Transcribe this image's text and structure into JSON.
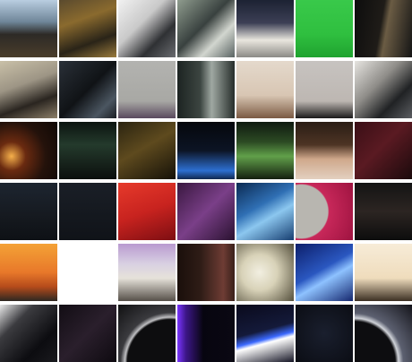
{
  "gallery": {
    "tiles": [
      {
        "name": "tile-monitors-rack",
        "bg": "linear-gradient(180deg,#b9cde0 0%,#6f8699 38%,#2d2a26 60%,#4a3d2b 100%)"
      },
      {
        "name": "tile-broadcast-console",
        "bg": "linear-gradient(160deg,#5a4a2e 0%,#8a6a2e 35%,#2a2418 70%,#9a7b3c 100%)"
      },
      {
        "name": "tile-studio-camera-white",
        "bg": "linear-gradient(135deg,#f1f1f1 0%,#c9c9c9 40%,#2f3134 70%,#6a6c70 100%)"
      },
      {
        "name": "tile-camera-operator",
        "bg": "linear-gradient(135deg,#8f9c8e 0%,#39413f 45%,#d2d6cf 70%,#596362 100%)"
      },
      {
        "name": "tile-camera-rig-blue",
        "bg": "linear-gradient(180deg,#1c2233 0%,#3c3f55 40%,#e9e6de 70%,#8b8a86 100%)"
      },
      {
        "name": "tile-green-screen",
        "bg": "linear-gradient(180deg,#39c94a 0%,#2fbf3f 60%,#1fa32f 100%)"
      },
      {
        "name": "tile-dark-equipment",
        "bg": "linear-gradient(100deg,#0d0d0d 0%,#1f1c18 45%,#6b5c44 55%,#151515 100%)"
      },
      {
        "name": "tile-camera-lens-closeup",
        "bg": "linear-gradient(160deg,#c9c0a8 0%,#9d9585 40%,#2a2520 70%,#8c7f69 100%)"
      },
      {
        "name": "tile-camera-shoulder",
        "bg": "linear-gradient(135deg,#2a3038 0%,#101316 50%,#4b5661 80%,#1b1f24 100%)"
      },
      {
        "name": "tile-grey-wall",
        "bg": "linear-gradient(180deg,#b3b3b0 0%,#a8a8a4 70%,#5a4a5e 100%)"
      },
      {
        "name": "tile-control-panel",
        "bg": "linear-gradient(90deg,#1d2422 0%,#3c4541 40%,#9fa8a2 60%,#262d2a 100%)"
      },
      {
        "name": "tile-studio-backdrop-text",
        "bg": "linear-gradient(180deg,#e4d9cc 0%,#d8c6b3 60%,#7b5a43 100%)"
      },
      {
        "name": "tile-audience-heads",
        "bg": "linear-gradient(180deg,#c7c3c0 0%,#bdb7b2 70%,#1b1a1a 100%)"
      },
      {
        "name": "tile-camera-side",
        "bg": "linear-gradient(135deg,#e6e4e0 0%,#8f8d89 40%,#202224 70%,#5c5e62 100%)"
      },
      {
        "name": "tile-lights-dark-red",
        "bg": "radial-gradient(circle at 20% 60%,#f6b04b 0%,#6a2a10 25%,#24120b 60%,#0f0805 100%)"
      },
      {
        "name": "tile-lighting-grid-green",
        "bg": "linear-gradient(180deg,#0c1410 0%,#243a2c 40%,#0b0f0d 100%)"
      },
      {
        "name": "tile-spotlights-yellow",
        "bg": "linear-gradient(150deg,#2b2411 0%,#5e4a1e 45%,#151108 100%)"
      },
      {
        "name": "tile-blue-stage-lights",
        "bg": "linear-gradient(180deg,#05070c 0%,#0c1424 50%,#2d6fd1 85%,#102850 100%)"
      },
      {
        "name": "tile-truss-green",
        "bg": "linear-gradient(180deg,#0f1a10 0%,#2c4a23 35%,#61a04a 60%,#14200f 100%)"
      },
      {
        "name": "tile-ceiling-lamp",
        "bg": "linear-gradient(180deg,#2a1d15 0%,#4d3424 40%,#cfa88b 65%,#e3d0c0 100%)"
      },
      {
        "name": "tile-red-equipment",
        "bg": "linear-gradient(135deg,#3a0f16 0%,#5a1a22 45%,#1b0a0c 100%)"
      },
      {
        "name": "tile-dark-navy",
        "bg": "linear-gradient(180deg,#1d2530 0%,#15191f 60%,#0e1115 100%)"
      },
      {
        "name": "tile-dark-blue-black",
        "bg": "linear-gradient(180deg,#1a1f27 0%,#101318 100%)"
      },
      {
        "name": "tile-red-surface",
        "bg": "linear-gradient(160deg,#e63a2b 0%,#c8231f 50%,#7d0e12 100%)"
      },
      {
        "name": "tile-purple-gradient",
        "bg": "linear-gradient(135deg,#3a1840 0%,#7a3f88 50%,#2a1230 100%)"
      },
      {
        "name": "tile-blue-screen-panel",
        "bg": "linear-gradient(150deg,#0b2a52 0%,#2f6fb4 40%,#8cc7ef 60%,#163d70 100%)"
      },
      {
        "name": "tile-pink-curve",
        "bg": "radial-gradient(circle at 10% 50%,#b8b6b0 0%,#b8b6b0 45%,#c8285a 47%,#9e1340 100%)"
      },
      {
        "name": "tile-dark-texture",
        "bg": "linear-gradient(180deg,#141414 0%,#2c2522 50%,#0d0d0d 100%)"
      },
      {
        "name": "tile-orange-landscape",
        "bg": "linear-gradient(180deg,#f4a236 0%,#e8782a 50%,#b54b1b 75%,#2d2721 100%)"
      },
      {
        "name": "tile-white-blank",
        "bg": "#ffffff"
      },
      {
        "name": "tile-lavender-wall",
        "bg": "linear-gradient(180deg,#b99ad0 0%,#d8d0e2 35%,#e6e2da 60%,#565049 100%)"
      },
      {
        "name": "tile-dark-brown-room",
        "bg": "linear-gradient(90deg,#1a0f0b 0%,#2e1c16 40%,#6e3c34 80%,#3a201a 100%)"
      },
      {
        "name": "tile-hazy-light",
        "bg": "radial-gradient(circle at 40% 50%,#f2efe1 0%,#d8d2b8 40%,#544f3c 100%)"
      },
      {
        "name": "tile-blue-abstract",
        "bg": "linear-gradient(150deg,#0d1f6b 0%,#2a57c0 45%,#8ec2ff 60%,#15276e 100%)"
      },
      {
        "name": "tile-shoji-screen",
        "bg": "linear-gradient(180deg,#f7ecd8 0%,#efdcbc 60%,#3b2f23 100%)"
      },
      {
        "name": "tile-night-scene-light",
        "bg": "linear-gradient(135deg,#e8e8e8 0%,#3b3b3f 30%,#0c0c10 70%,#1a1a1e 100%)"
      },
      {
        "name": "tile-dark-purple",
        "bg": "linear-gradient(135deg,#120d14 0%,#2a1f2c 50%,#0e0a10 100%)"
      },
      {
        "name": "tile-grey-arc",
        "bg": "radial-gradient(circle at 90% 100%,#0d0d0f 0%,#0d0d0f 55%,#bfbfc2 58%,#3a3a3e 64%,#101012 100%)"
      },
      {
        "name": "tile-violet-glow",
        "bg": "linear-gradient(90deg,#7a35ff 0%,#3d1688 15%,#070510 45%,#0a0812 100%)"
      },
      {
        "name": "tile-blue-white-stage",
        "bg": "linear-gradient(165deg,#0a0a1c 0%,#141a3a 45%,#3b69ff 58%,#ffffff 64%,#151525 100%)"
      },
      {
        "name": "tile-starry-dark",
        "bg": "radial-gradient(circle at 50% 50%,#1a1f2e 0%,#0b0d14 100%)"
      },
      {
        "name": "tile-silver-curve",
        "bg": "radial-gradient(circle at 0% 100%,#0d0d10 0%,#0d0d10 50%,#cfd2d8 54%,#5c6070 60%,#14141a 100%)"
      }
    ]
  }
}
